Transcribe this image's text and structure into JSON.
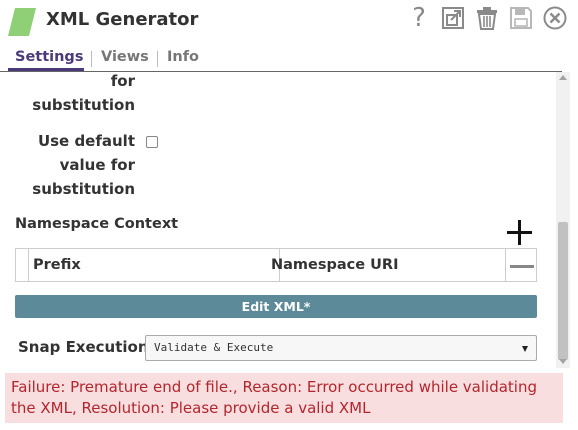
{
  "header": {
    "title": "XML Generator",
    "logo_color": "#8fcf76",
    "icons": [
      "help-icon",
      "export-icon",
      "delete-icon",
      "save-icon",
      "close-icon"
    ]
  },
  "tabs": [
    {
      "label": "Settings",
      "active": true
    },
    {
      "label": "Views",
      "active": false
    },
    {
      "label": "Info",
      "active": false
    }
  ],
  "settings": {
    "prev_label_tail": [
      "for",
      "substitution"
    ],
    "use_default_label": [
      "Use default",
      "value for",
      "substitution"
    ],
    "use_default_checked": false,
    "namespace_context": {
      "title": "Namespace Context",
      "columns": [
        "Prefix",
        "Namespace URI"
      ]
    },
    "edit_xml_label": "Edit XML*",
    "snap_execution": {
      "label": "Snap Execution",
      "selected": "Validate & Execute"
    }
  },
  "error": {
    "message": "Failure: Premature end of file., Reason: Error occurred while validating the XML, Resolution: Please provide a valid XML",
    "background": "#f8dede",
    "text_color": "#b3262e"
  },
  "colors": {
    "accent": "#4a3a7a",
    "button": "#5d8a98"
  }
}
